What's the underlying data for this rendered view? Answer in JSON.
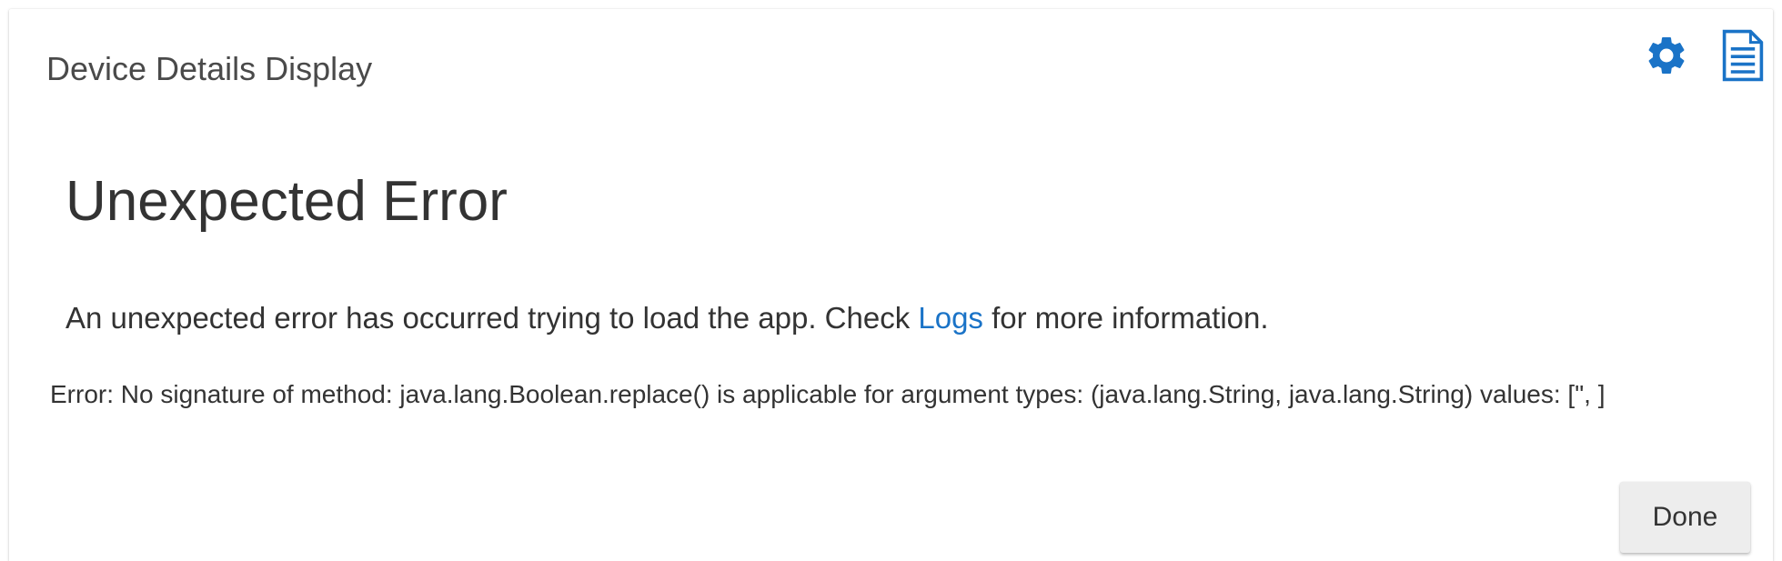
{
  "app": {
    "title": "Device Details Display"
  },
  "header": {
    "settings_icon": "gear-icon",
    "logs_icon": "document-icon",
    "icon_color": "#1a73c7"
  },
  "error": {
    "heading": "Unexpected Error",
    "message_before": "An unexpected error has occurred trying to load the app. Check ",
    "logs_link_label": "Logs",
    "message_after": " for more information.",
    "detail": "Error: No signature of method: java.lang.Boolean.replace() is applicable for argument types: (java.lang.String, java.lang.String) values: [\", ]"
  },
  "actions": {
    "done_label": "Done"
  },
  "colors": {
    "accent": "#1a73c7",
    "text": "#333333",
    "button_bg": "#ededed"
  }
}
